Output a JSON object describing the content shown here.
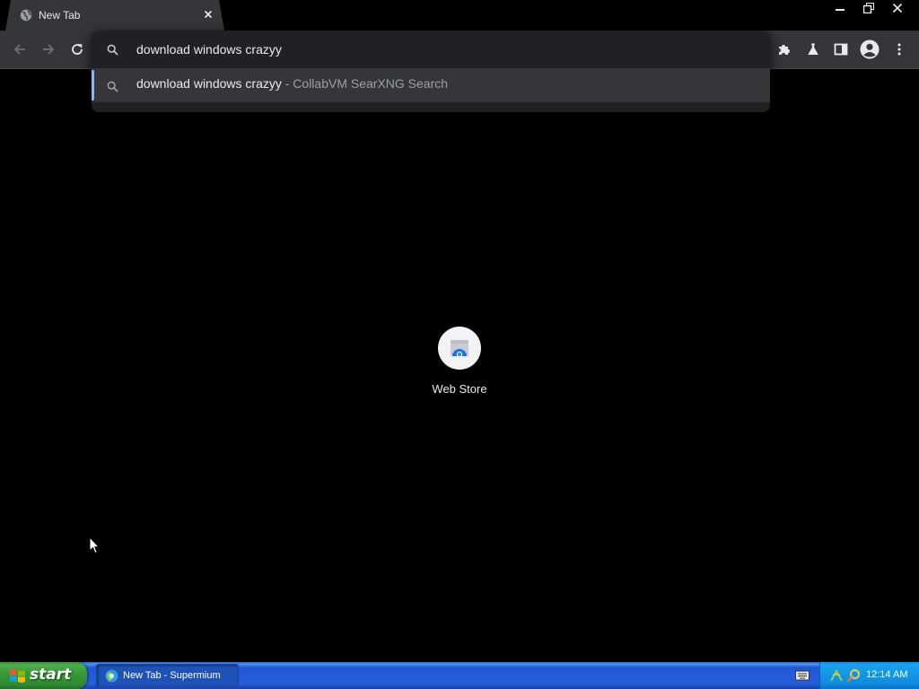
{
  "tab": {
    "title": "New Tab",
    "favicon": "globe-icon",
    "close_icon": "close-icon"
  },
  "window_controls": {
    "minimize_icon": "minimize-icon",
    "restore_icon": "restore-icon",
    "close_icon": "close-icon"
  },
  "toolbar": {
    "back_icon": "arrow-left-icon",
    "forward_icon": "arrow-right-icon",
    "reload_icon": "reload-icon",
    "extensions_icon": "puzzle-icon",
    "labs_icon": "flask-icon",
    "side_panel_icon": "side-panel-icon",
    "profile_icon": "account-circle-icon",
    "menu_icon": "more-vert-icon"
  },
  "omnibox": {
    "value": "download windows crazyy",
    "suggestion": {
      "query": "download windows crazyy",
      "description": " - CollabVM SearXNG Search"
    },
    "accent_color": "#8ab4f8"
  },
  "ntp": {
    "shortcuts": [
      {
        "label": "Web Store",
        "icon": "web-store-icon"
      }
    ]
  },
  "taskbar": {
    "start_label": "start",
    "task_label": "New Tab - Supermium",
    "clock": "12:14 AM",
    "colors": {
      "taskbar": "#245edb",
      "start": "#389a38",
      "tray": "#0f8be0"
    }
  }
}
